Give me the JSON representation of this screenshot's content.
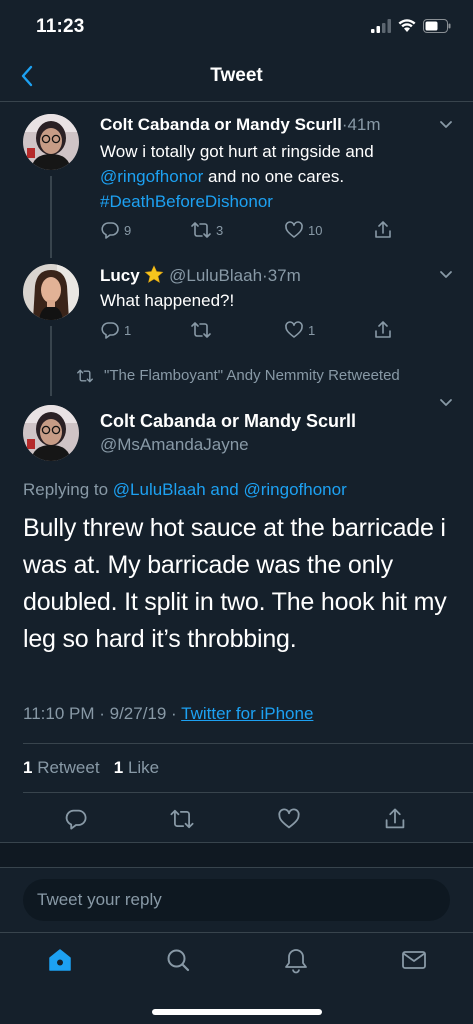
{
  "status_bar": {
    "time": "11:23"
  },
  "nav": {
    "title": "Tweet"
  },
  "thread": [
    {
      "name": "Colt Cabanda or Mandy Scurll",
      "meta": "·41m",
      "text_pre": "Wow i totally got hurt at ringside and",
      "mention": "@ringofhonor",
      "text_post": " and no one cares.",
      "hashtag": "#DeathBeforeDishonor",
      "replies": "9",
      "retweets": "3",
      "likes": "10"
    },
    {
      "name": "Lucy",
      "handle": "@LuluBlaah",
      "meta": "·37m",
      "text": "What happened?!",
      "replies": "1",
      "retweets": "",
      "likes": "1"
    }
  ],
  "retweeted_label": "\"The Flamboyant\" Andy Nemmity Retweeted",
  "main_tweet": {
    "name": "Colt Cabanda or Mandy Scurll",
    "handle": "@MsAmandaJayne",
    "replying_prefix": "Replying to ",
    "replying_to": "@LuluBlaah and @ringofhonor",
    "text": "Bully threw hot sauce at the barricade i was at. My barricade was the only doubled. It split in two. The hook hit my leg so hard it’s throbbing.",
    "timestamp": "11:10 PM · 9/27/19 · ",
    "source": "Twitter for iPhone",
    "retweet_count": "1",
    "retweet_label": "Retweet",
    "like_count": "1",
    "like_label": "Like"
  },
  "reply_box": {
    "placeholder": "Tweet your reply"
  },
  "colors": {
    "background": "#15202b",
    "accent": "#1da1f2",
    "secondary_text": "#8899a6",
    "border": "#38444d"
  },
  "icons": [
    "back-icon",
    "chevron-down-icon",
    "reply-icon",
    "retweet-icon",
    "like-icon",
    "share-icon",
    "home-icon",
    "search-icon",
    "notifications-icon",
    "messages-icon"
  ]
}
